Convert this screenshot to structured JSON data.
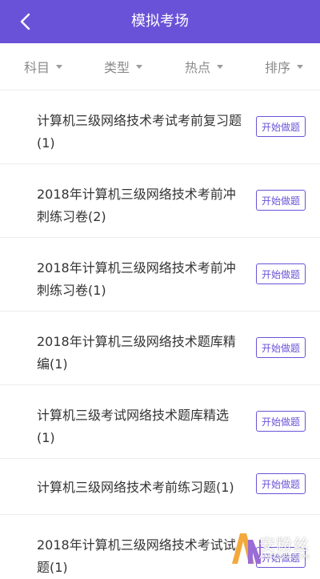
{
  "header": {
    "title": "模拟考场",
    "back_icon": "chevron-left-icon",
    "bg_color": "#6a52d8"
  },
  "filters": [
    {
      "label": "科目"
    },
    {
      "label": "类型"
    },
    {
      "label": "热点"
    },
    {
      "label": "排序"
    }
  ],
  "items": [
    {
      "title": "计算机三级网络技术考试考前复习题(1)",
      "button": "开始做题"
    },
    {
      "title": "2018年计算机三级网络技术考前冲刺练习卷(2)",
      "button": "开始做题"
    },
    {
      "title": "2018年计算机三级网络技术考前冲刺练习卷(1)",
      "button": "开始做题"
    },
    {
      "title": "2018年计算机三级网络技术题库精编(1)",
      "button": "开始做题"
    },
    {
      "title": "计算机三级考试网络技术题库精选(1)",
      "button": "开始做题"
    },
    {
      "title": "计算机三级网络技术考前练习题(1)",
      "button": "开始做题"
    },
    {
      "title": "2018年计算机三级网络技术考试试题(1)",
      "button": "开始做题"
    }
  ],
  "watermark": {
    "text": "安粉丝",
    "sub": "ANFENSI.COM"
  }
}
